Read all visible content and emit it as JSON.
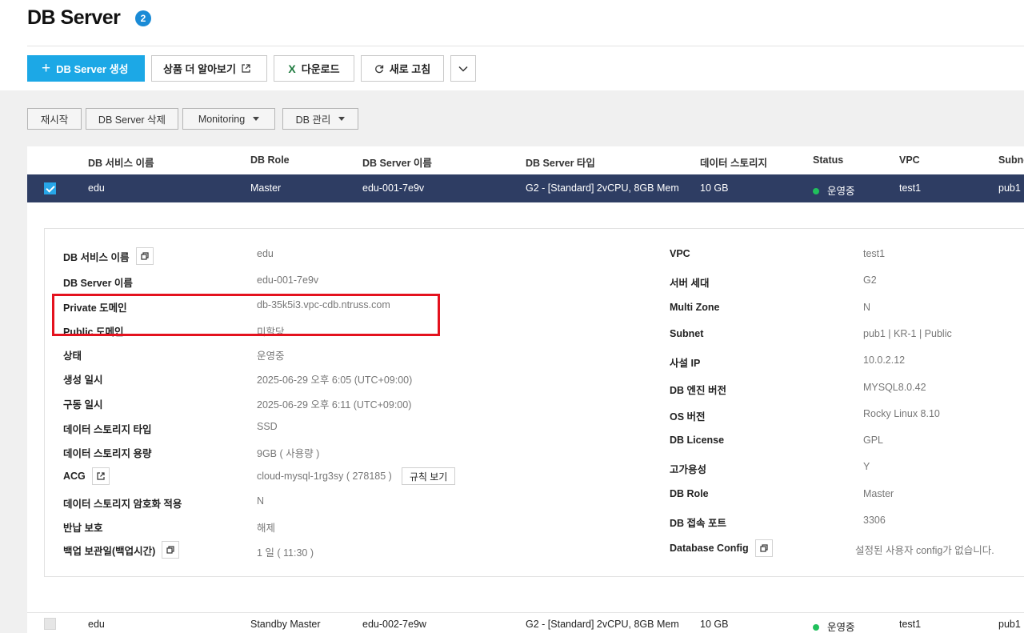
{
  "header": {
    "title": "DB Server",
    "badge": "2"
  },
  "toolbar": {
    "create_label": "DB Server 생성",
    "learn_more_label": "상품 더 알아보기",
    "download_label": "다운로드",
    "refresh_label": "새로 고침"
  },
  "actions": {
    "restart_label": "재시작",
    "delete_label": "DB Server 삭제",
    "monitoring_label": "Monitoring",
    "db_manage_label": "DB 관리"
  },
  "table": {
    "columns": [
      "DB 서비스 이름",
      "DB Role",
      "DB Server 이름",
      "DB Server 타입",
      "데이터 스토리지",
      "Status",
      "VPC",
      "Subnet"
    ],
    "rows": [
      {
        "service_name": "edu",
        "role": "Master",
        "server_name": "edu-001-7e9v",
        "server_type": "G2 - [Standard] 2vCPU, 8GB Mem",
        "storage": "10 GB",
        "status": "운영중",
        "vpc": "test1",
        "subnet": "pub1",
        "selected": true
      },
      {
        "service_name": "edu",
        "role": "Standby Master",
        "server_name": "edu-002-7e9w",
        "server_type": "G2 - [Standard] 2vCPU, 8GB Mem",
        "storage": "10 GB",
        "status": "운영중",
        "vpc": "test1",
        "subnet": "pub1",
        "selected": false
      }
    ]
  },
  "detail": {
    "left": [
      {
        "label": "DB 서비스 이름",
        "value": "edu"
      },
      {
        "label": "DB Server 이름",
        "value": "edu-001-7e9v"
      },
      {
        "label": "Private 도메인",
        "value": "db-35k5i3.vpc-cdb.ntruss.com"
      },
      {
        "label": "Public 도메인",
        "value": "미할당"
      },
      {
        "label": "상태",
        "value": "운영중"
      },
      {
        "label": "생성 일시",
        "value": "2025-06-29 오후 6:05 (UTC+09:00)"
      },
      {
        "label": "구동 일시",
        "value": "2025-06-29 오후 6:11 (UTC+09:00)"
      },
      {
        "label": "데이터 스토리지 타입",
        "value": "SSD"
      },
      {
        "label": "데이터 스토리지 용량",
        "value": "9GB ( 사용량 )"
      },
      {
        "label": "ACG",
        "value": "cloud-mysql-1rg3sy ( 278185 )",
        "button": "규칙 보기"
      },
      {
        "label": "데이터 스토리지 암호화 적용",
        "value": "N"
      },
      {
        "label": "반납 보호",
        "value": "해제"
      },
      {
        "label": "백업 보관일(백업시간)",
        "value": "1 일 ( 11:30 )"
      }
    ],
    "right": [
      {
        "label": "VPC",
        "value": "test1"
      },
      {
        "label": "서버 세대",
        "value": "G2"
      },
      {
        "label": "Multi Zone",
        "value": "N"
      },
      {
        "label": "Subnet",
        "value": "pub1 | KR-1 | Public"
      },
      {
        "label": "사설 IP",
        "value": "10.0.2.12"
      },
      {
        "label": "DB 엔진 버전",
        "value": "MYSQL8.0.42"
      },
      {
        "label": "OS 버전",
        "value": "Rocky Linux 8.10"
      },
      {
        "label": "DB License",
        "value": "GPL"
      },
      {
        "label": "고가용성",
        "value": "Y"
      },
      {
        "label": "DB Role",
        "value": "Master"
      },
      {
        "label": "DB 접속 포트",
        "value": "3306"
      },
      {
        "label": "Database Config",
        "value": "설정된 사용자 config가 없습니다."
      }
    ]
  },
  "colors": {
    "primary": "#1ca8e6",
    "selected_row": "#2e3d63",
    "status_running": "#20c05c",
    "highlight": "#e4121e"
  },
  "icons": [
    "plus-icon",
    "external-link-icon",
    "excel-icon",
    "refresh-icon",
    "chevron-down-icon",
    "caret-down-icon",
    "copy-icon",
    "checkbox-icon",
    "status-dot-icon"
  ]
}
